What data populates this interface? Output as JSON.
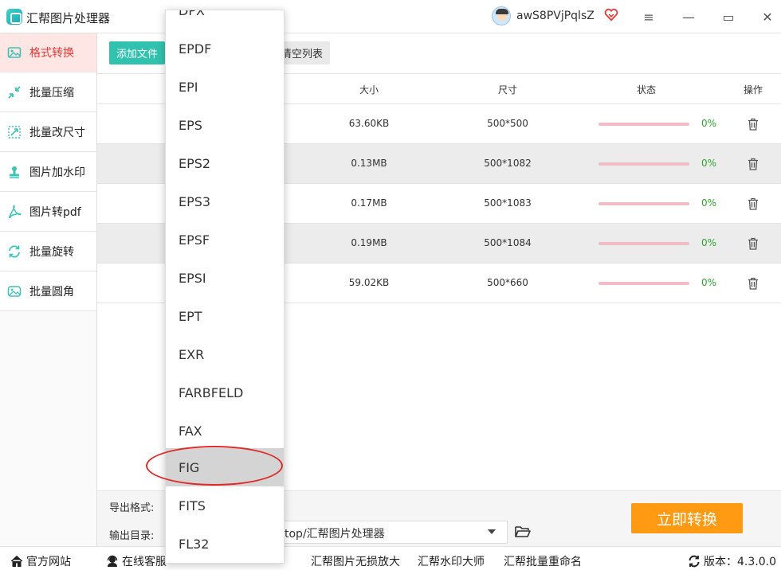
{
  "app": {
    "title": "汇帮图片处理器",
    "username": "awS8PVjPqlsZ"
  },
  "window": {
    "menu_icon": "≡",
    "minimize_icon": "—",
    "maximize_icon": "▭",
    "close_icon": "✕"
  },
  "sidebar": {
    "items": [
      {
        "label": "格式转换",
        "icon": "image-convert-icon"
      },
      {
        "label": "批量压缩",
        "icon": "compress-icon"
      },
      {
        "label": "批量改尺寸",
        "icon": "resize-icon"
      },
      {
        "label": "图片加水印",
        "icon": "watermark-icon"
      },
      {
        "label": "图片转pdf",
        "icon": "pdf-icon"
      },
      {
        "label": "批量旋转",
        "icon": "rotate-icon"
      },
      {
        "label": "批量圆角",
        "icon": "round-corner-icon"
      }
    ]
  },
  "toolbar": {
    "add_label": "添加文件",
    "clear_label": "清空列表"
  },
  "table": {
    "headers": {
      "size": "大小",
      "dimensions": "尺寸",
      "status": "状态",
      "action": "操作"
    },
    "rows": [
      {
        "size": "63.60KB",
        "dimensions": "500*500",
        "progress": 0,
        "pct": "0%"
      },
      {
        "size": "0.13MB",
        "dimensions": "500*1082",
        "progress": 0,
        "pct": "0%"
      },
      {
        "size": "0.17MB",
        "dimensions": "500*1083",
        "progress": 0,
        "pct": "0%"
      },
      {
        "size": "0.19MB",
        "dimensions": "500*1084",
        "progress": 0,
        "pct": "0%"
      },
      {
        "size": "59.02KB",
        "dimensions": "500*660",
        "progress": 0,
        "pct": "0%"
      }
    ]
  },
  "options": {
    "export_format_label": "导出格式:",
    "output_dir_label": "输出目录:",
    "output_dir_value": "top/汇帮图片处理器"
  },
  "convert_button": "立即转换",
  "footer": {
    "website": "官方网站",
    "support": "在线客服",
    "link1": "汇帮图片无损放大",
    "link2": "汇帮水印大师",
    "link3": "汇帮批量重命名",
    "version": "版本：4.3.0.0"
  },
  "dropdown": {
    "partial_top": "DPX",
    "options": [
      "EPDF",
      "EPI",
      "EPS",
      "EPS2",
      "EPS3",
      "EPSF",
      "EPSI",
      "EPT",
      "EXR",
      "FARBFELD",
      "FAX",
      "FIG",
      "FITS",
      "FL32"
    ],
    "selected": "FIG"
  },
  "colors": {
    "accent": "#30c2ae",
    "active_nav": "#e53935",
    "convert": "#ff9a12",
    "annotation": "#e02a2a"
  }
}
